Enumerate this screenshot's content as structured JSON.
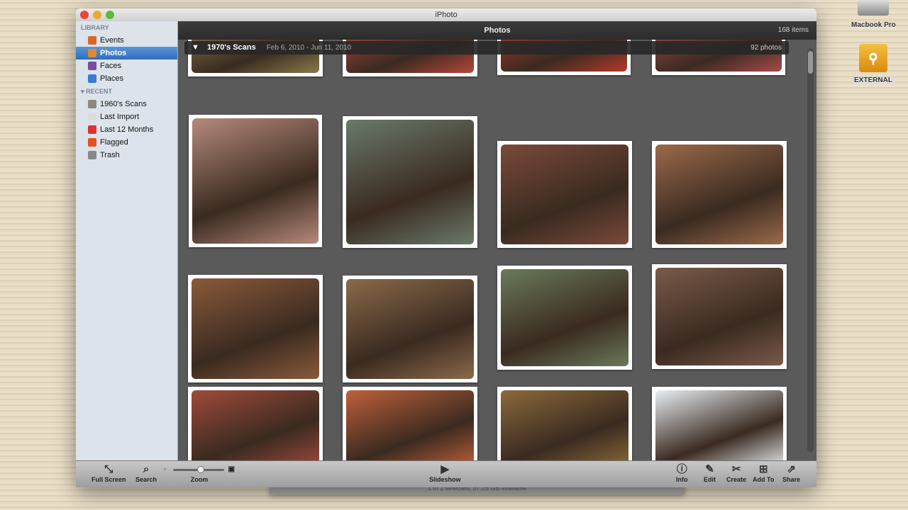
{
  "window": {
    "title": "iPhoto"
  },
  "desktop": {
    "icons": [
      {
        "label": "Macbook Pro",
        "icon": "hard-drive-icon"
      },
      {
        "label": "EXTERNAL",
        "icon": "usb-drive-icon"
      }
    ]
  },
  "sidebar": {
    "library_heading": "LIBRARY",
    "library": [
      {
        "label": "Events",
        "icon": "events-icon",
        "color": "#d9652a"
      },
      {
        "label": "Photos",
        "icon": "photos-icon",
        "color": "#e08a34",
        "selected": true
      },
      {
        "label": "Faces",
        "icon": "faces-icon",
        "color": "#7a4aa0"
      },
      {
        "label": "Places",
        "icon": "globe-icon",
        "color": "#3a7bd5"
      }
    ],
    "recent_heading": "RECENT",
    "recent": [
      {
        "label": "1960's Scans",
        "icon": "album-icon",
        "color": "#8a8a7a"
      },
      {
        "label": "Last Import",
        "icon": "clock-icon",
        "color": "#ddd"
      },
      {
        "label": "Last 12 Months",
        "icon": "calendar-icon",
        "color": "#d33"
      },
      {
        "label": "Flagged",
        "icon": "flag-icon",
        "color": "#e4541e"
      },
      {
        "label": "Trash",
        "icon": "trash-icon",
        "color": "#888"
      }
    ]
  },
  "header": {
    "title": "Photos",
    "count": "168 items"
  },
  "event": {
    "name": "1970's Scans",
    "dates": "Feb 6, 2010 - Jun 11, 2010",
    "count": "92 photos"
  },
  "photos": [
    {
      "tone": "#8a7a4a"
    },
    {
      "tone": "#b8463a"
    },
    {
      "tone": "#b43b2a"
    },
    {
      "tone": "#a84a4a"
    },
    {
      "tone": "#b58a7a"
    },
    {
      "tone": "#6a7a6a"
    },
    {
      "tone": "#7a4a3a"
    },
    {
      "tone": "#9a6a4a"
    },
    {
      "tone": "#8a5a3a"
    },
    {
      "tone": "#8a6a4a"
    },
    {
      "tone": "#6a7a5a"
    },
    {
      "tone": "#7a5a4a"
    },
    {
      "tone": "#a04a3a"
    },
    {
      "tone": "#c0603a"
    },
    {
      "tone": "#8a6a3a"
    },
    {
      "tone": "#e8eef2"
    }
  ],
  "toolbar": {
    "full_screen": "Full Screen",
    "search": "Search",
    "zoom": "Zoom",
    "slideshow": "Slideshow",
    "info": "Info",
    "edit": "Edit",
    "create": "Create",
    "add_to": "Add To",
    "share": "Share",
    "zoom_level": 0.55
  },
  "status": "1 of 2 selected, 37.25 GB available"
}
